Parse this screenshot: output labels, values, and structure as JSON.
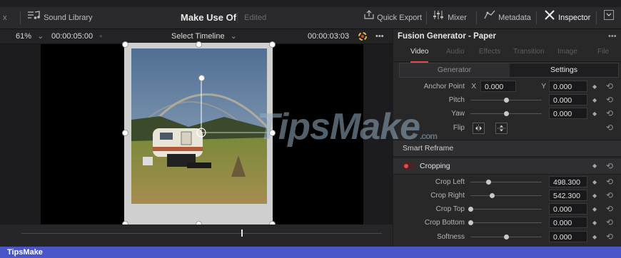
{
  "app": {
    "project_title": "Make Use Of",
    "project_state": "Edited",
    "left_edge_text": "x",
    "sound_library_label": "Sound Library",
    "quick_export_label": "Quick Export",
    "mixer_label": "Mixer",
    "metadata_label": "Metadata",
    "inspector_label": "Inspector"
  },
  "viewer": {
    "zoom": "61%",
    "timecode_left": "00:00:05:00",
    "timeline_select": "Select Timeline",
    "timecode_right": "00:00:03:03",
    "more_glyph": "•••",
    "playhead_progress": 0.61
  },
  "inspector": {
    "clip_title": "Fusion Generator - Paper",
    "more_glyph": "•••",
    "tabs": [
      "Video",
      "Audio",
      "Effects",
      "Transition",
      "Image",
      "File"
    ],
    "active_tab": "Video",
    "segments": [
      "Generator",
      "Settings"
    ],
    "active_segment": "Settings",
    "anchor": {
      "label": "Anchor Point",
      "x_label": "X",
      "x_value": "0.000",
      "y_label": "Y",
      "y_value": "0.000"
    },
    "transform_rows": [
      {
        "label": "Pitch",
        "value": "0.000",
        "slider": 0.5
      },
      {
        "label": "Yaw",
        "value": "0.000",
        "slider": 0.5
      }
    ],
    "flip_label": "Flip",
    "smart_reframe_label": "Smart Reframe",
    "cropping_label": "Cropping",
    "crop_rows": [
      {
        "label": "Crop Left",
        "value": "498.300",
        "slider": 0.25
      },
      {
        "label": "Crop Right",
        "value": "542.300",
        "slider": 0.3
      },
      {
        "label": "Crop Top",
        "value": "0.000",
        "slider": 0.0
      },
      {
        "label": "Crop Bottom",
        "value": "0.000",
        "slider": 0.0
      },
      {
        "label": "Softness",
        "value": "0.000",
        "slider": 0.5
      }
    ]
  },
  "watermark": {
    "text": "TipsMake",
    "suffix": ".com"
  },
  "footer": {
    "brand": "TipsMake"
  },
  "colors": {
    "accent_red": "#e5484d",
    "footer_blue": "#4a56c8"
  }
}
